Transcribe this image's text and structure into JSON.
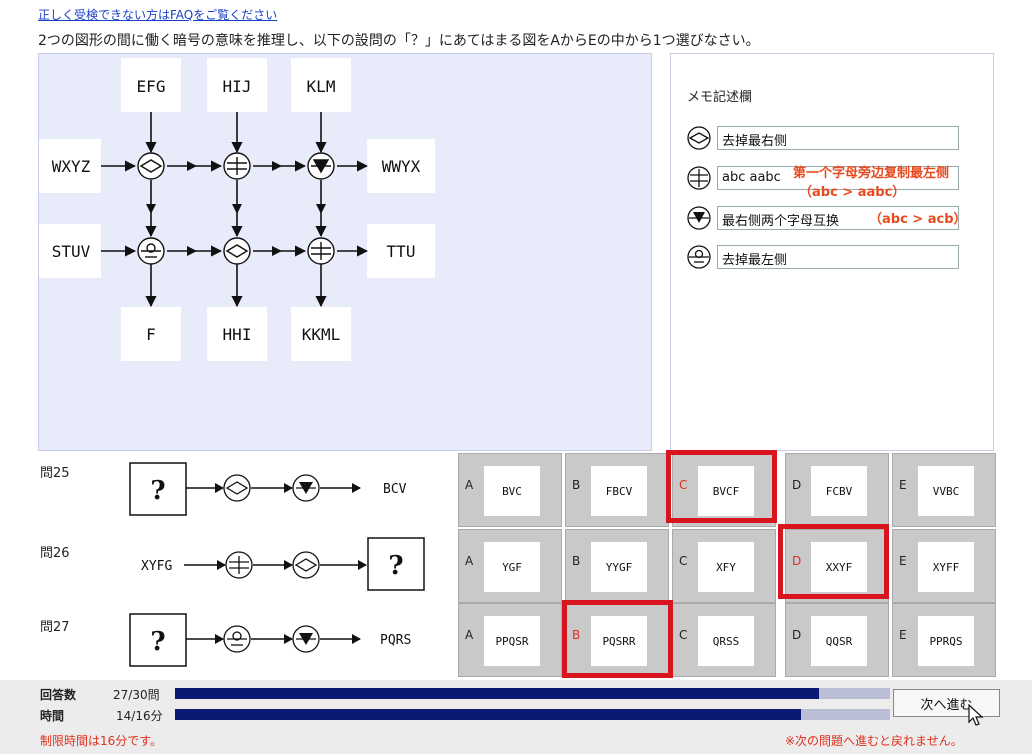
{
  "header": {
    "faq_link": "正しく受検できない方はFAQをご覧ください",
    "question": "2つの図形の間に働く暗号の意味を推理し、以下の設問の「？」にあてはまる図をAからEの中から1つ選びなさい。"
  },
  "diagram": {
    "top_inputs": [
      "EFG",
      "HIJ",
      "KLM"
    ],
    "row1_left": "WXYZ",
    "row1_right": "WWYX",
    "row2_left": "STUV",
    "row2_right": "TTU",
    "bottom_outputs": [
      "F",
      "HHI",
      "KKML"
    ]
  },
  "memo": {
    "title": "メモ記述欄",
    "rows": [
      {
        "symbol": "diamond",
        "value": "去掉最右侧"
      },
      {
        "symbol": "equal",
        "value": "abc aabc"
      },
      {
        "symbol": "triangle",
        "value": "最右侧两个字母互换"
      },
      {
        "symbol": "circle-bar",
        "value": "去掉最左侧"
      }
    ],
    "annotation_1a": "第一个字母旁边复制最左侧",
    "annotation_1b": "（abc > aabc）",
    "annotation_2": "（abc > acb）"
  },
  "questions": [
    {
      "label": "問25",
      "left": "?",
      "right": "BCV",
      "options": [
        {
          "letter": "A",
          "text": "BVC"
        },
        {
          "letter": "B",
          "text": "FBCV"
        },
        {
          "letter": "C",
          "text": "BVCF"
        },
        {
          "letter": "D",
          "text": "FCBV"
        },
        {
          "letter": "E",
          "text": "VVBC"
        }
      ]
    },
    {
      "label": "問26",
      "left": "XYFG",
      "right": "?",
      "options": [
        {
          "letter": "A",
          "text": "YGF"
        },
        {
          "letter": "B",
          "text": "YYGF"
        },
        {
          "letter": "C",
          "text": "XFY"
        },
        {
          "letter": "D",
          "text": "XXYF"
        },
        {
          "letter": "E",
          "text": "XYFF"
        }
      ]
    },
    {
      "label": "問27",
      "left": "?",
      "right": "PQRS",
      "options": [
        {
          "letter": "A",
          "text": "PPQSR"
        },
        {
          "letter": "B",
          "text": "PQSRR"
        },
        {
          "letter": "C",
          "text": "QRSS"
        },
        {
          "letter": "D",
          "text": "QQSR"
        },
        {
          "letter": "E",
          "text": "PPRQS"
        }
      ]
    }
  ],
  "footer": {
    "answers_label": "回答数",
    "answers_value": "27/30問",
    "answers_fraction": 0.9,
    "time_label": "時間",
    "time_value": "14/16分",
    "time_fraction": 0.875,
    "limit_text": "制限時間は16分です。",
    "next_button": "次へ進む",
    "warning": "※次の問題へ進むと戻れません。"
  },
  "colors": {
    "accent_red": "#d8141f",
    "bar_fill": "#0b1a70",
    "panel_bg": "#e8ebfa"
  }
}
